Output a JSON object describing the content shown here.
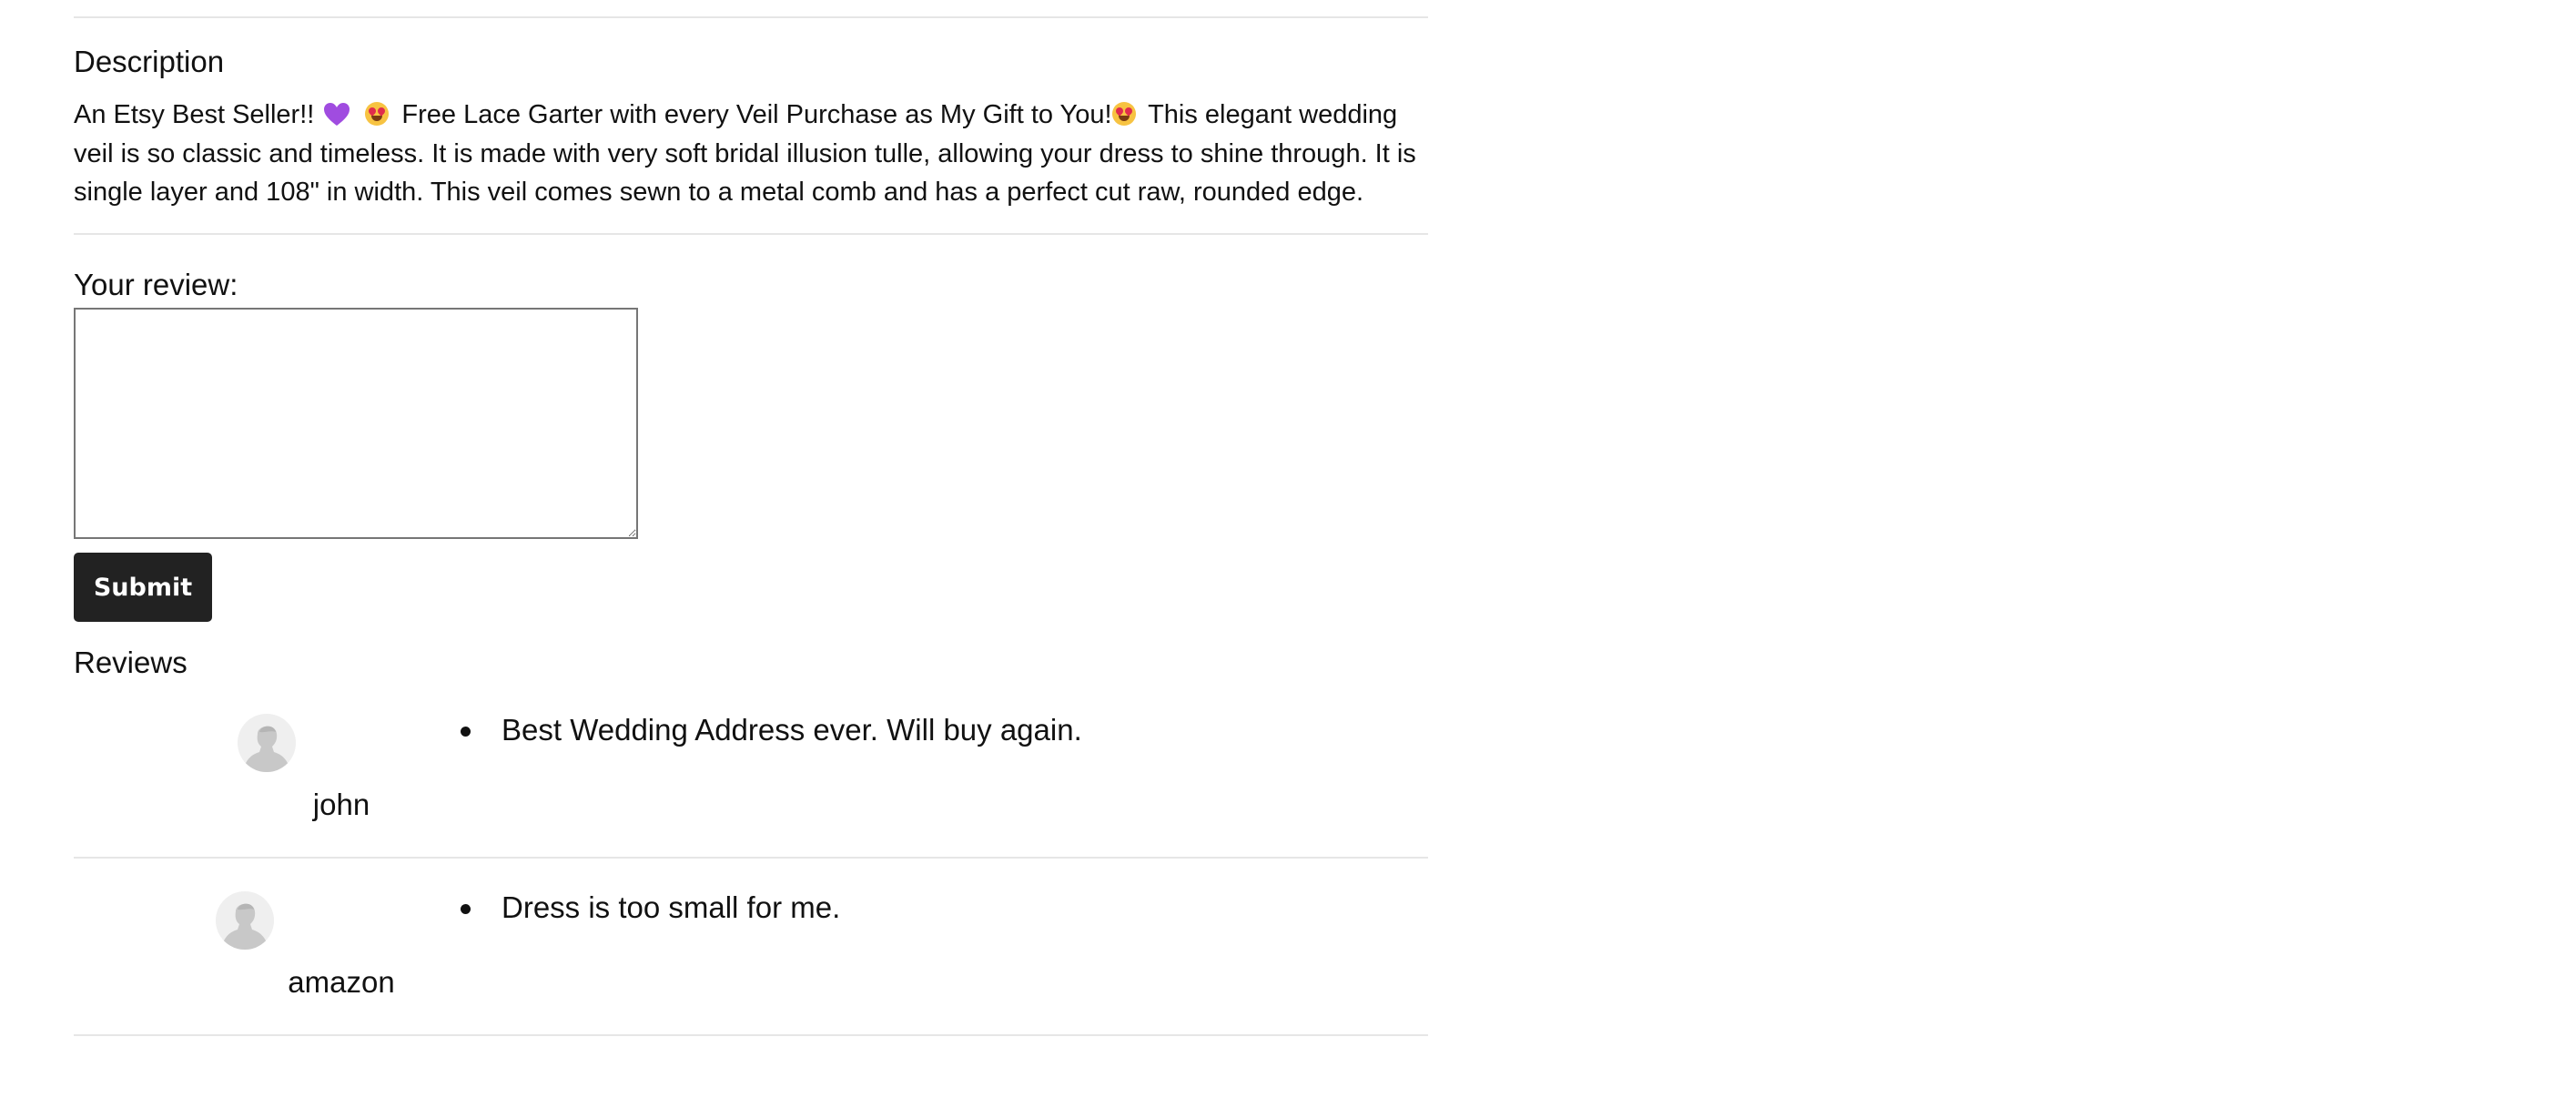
{
  "description": {
    "heading": "Description",
    "part1": "An Etsy Best Seller!!",
    "part2": "Free Lace Garter with every Veil Purchase as My Gift to You!",
    "part3": "This elegant wedding veil is so classic and timeless. It is made with very soft bridal illusion tulle, allowing your dress to shine through. It is single layer and 108\" in width. This veil comes sewn to a metal comb and has a perfect cut raw, rounded edge.",
    "icons": [
      "purple-heart-icon",
      "heart-eyes-emoji-icon",
      "heart-eyes-emoji-icon"
    ]
  },
  "review_form": {
    "label": "Your review:",
    "textarea_value": "",
    "submit_label": "Submit"
  },
  "reviews": {
    "heading": "Reviews",
    "items": [
      {
        "user": "john",
        "text": "Best Wedding Address ever. Will buy again.",
        "avatar_icon": "user-avatar-icon"
      },
      {
        "user": "amazon",
        "text": "Dress is too small for me.",
        "avatar_icon": "user-avatar-icon"
      }
    ]
  },
  "colors": {
    "button_bg": "#222222",
    "button_text": "#ffffff",
    "divider": "#e6e6e6",
    "text": "#111111"
  }
}
